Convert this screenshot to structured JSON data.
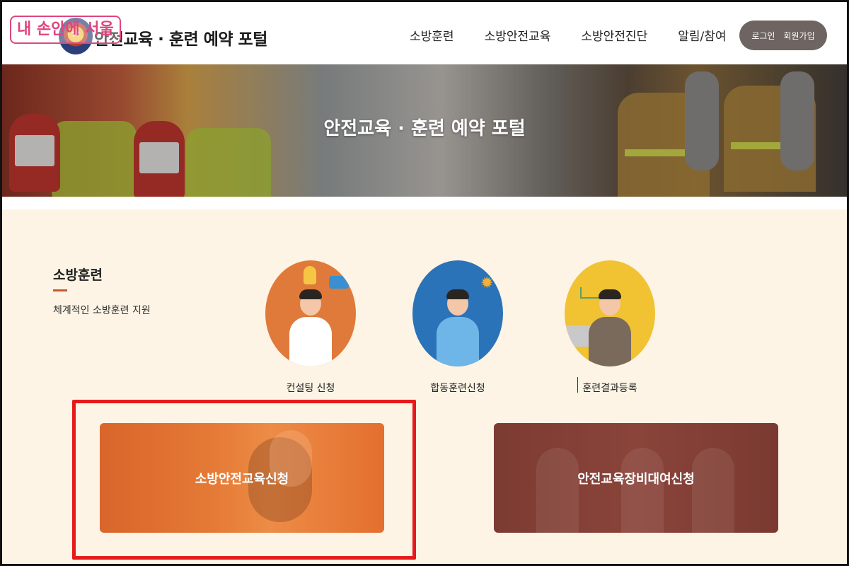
{
  "watermark": "내 손안에 서울",
  "header": {
    "portal_title": "안전교육 · 훈련 예약 포털",
    "nav": [
      "소방훈련",
      "소방안전교육",
      "소방안전진단",
      "알림/참여"
    ],
    "login_label": "로그인",
    "signup_label": "회원가입"
  },
  "hero": {
    "title": "안전교육 · 훈련 예약 포털"
  },
  "section": {
    "title": "소방훈련",
    "subtitle": "체계적인 소방훈련 지원",
    "services": [
      {
        "label": "컨설팅 신청",
        "icon": "consulting-person-icon"
      },
      {
        "label": "합동훈련신청",
        "icon": "joint-training-person-icon"
      },
      {
        "label": "훈련결과등록",
        "icon": "result-registration-person-icon"
      }
    ]
  },
  "cards": [
    {
      "label": "소방안전교육신청",
      "color": "#e57a36"
    },
    {
      "label": "안전교육장비대여신청",
      "color": "#7c3b32"
    }
  ],
  "colors": {
    "accent": "#c35a2e",
    "highlight": "#e51a1a",
    "content_bg": "#fdf4e5",
    "auth_button": "#6e6462"
  }
}
